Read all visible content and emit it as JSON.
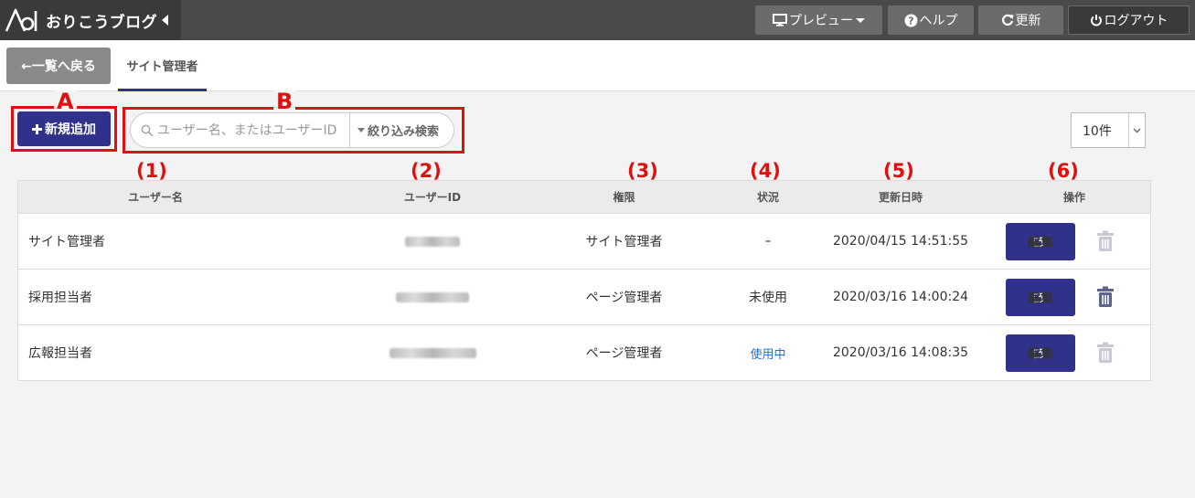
{
  "app": {
    "title": "おりこうブログ"
  },
  "topbar": {
    "preview_label": "プレビュー",
    "help_label": "ヘルプ",
    "refresh_label": "更新",
    "logout_label": "ログアウト"
  },
  "nav": {
    "back_label": "←一覧へ戻る",
    "active_tab": "サイト管理者"
  },
  "toolbar": {
    "add_label": "新規追加",
    "search_placeholder": "ユーザー名、またはユーザーID",
    "filter_label": "絞り込み検索",
    "per_page": "10件"
  },
  "annotations": {
    "A": "A",
    "B": "B",
    "col1": "(1)",
    "col2": "(2)",
    "col3": "(3)",
    "col4": "(4)",
    "col5": "(5)",
    "col6": "(6)"
  },
  "table": {
    "headers": [
      "ユーザー名",
      "ユーザーID",
      "権限",
      "状況",
      "更新日時",
      "操作"
    ],
    "edit_label": "編集",
    "rows": [
      {
        "name": "サイト管理者",
        "role": "サイト管理者",
        "status": "–",
        "updated": "2020/04/15 14:51:55"
      },
      {
        "name": "採用担当者",
        "role": "ページ管理者",
        "status": "未使用",
        "updated": "2020/03/16 14:00:24"
      },
      {
        "name": "広報担当者",
        "role": "ページ管理者",
        "status": "使用中",
        "updated": "2020/03/16 14:08:35"
      }
    ]
  },
  "colors": {
    "primary": "#2f318a",
    "annotation": "#e01010",
    "link": "#1a6fd0"
  },
  "icons": [
    "logo-icon",
    "collapse-caret-icon",
    "monitor-icon",
    "help-icon",
    "refresh-icon",
    "power-icon",
    "search-icon",
    "edit-icon",
    "trash-icon"
  ]
}
